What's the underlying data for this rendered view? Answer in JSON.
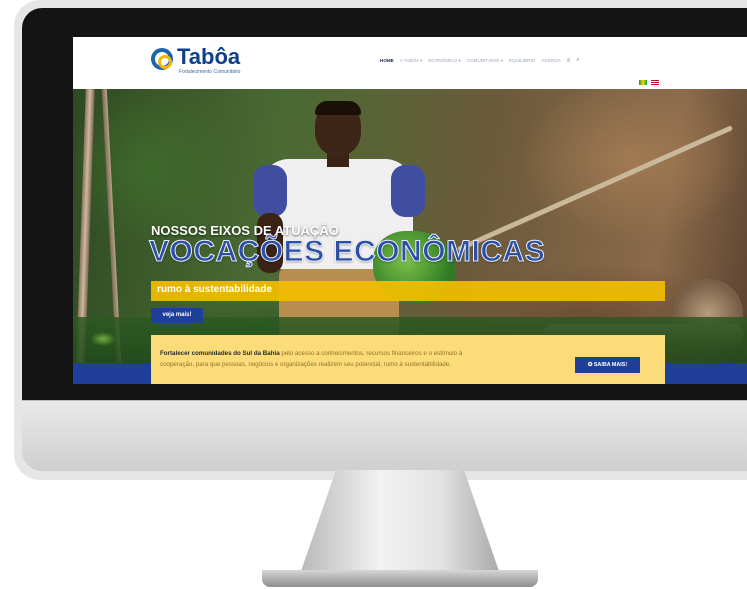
{
  "site": {
    "logo_name": "Tabôa",
    "logo_tagline": "Fortalecimento Comunitário"
  },
  "nav": {
    "items": [
      "HOME",
      "A TABÔA ▾",
      "ECONÔMICO ▾",
      "COMUNITÁRIO ▾",
      "EQUILÍBRIO",
      "AGENDA"
    ],
    "menu_icon": "≡",
    "search_icon": "⌕"
  },
  "hero": {
    "subtitle": "NOSSOS EIXOS DE ATUAÇÃO",
    "title": "VOCAÇÕES ECONÔMICAS",
    "tagline": "rumo à sustentabilidade",
    "cta_label": "veja mais!"
  },
  "info": {
    "bold": "Fortalecer comunidades do Sul da Bahia",
    "text": " pelo acesso a conhecimentos, recursos financeiros e o estímulo à cooperação, para que pessoas, negócios e organizações realizem seu potencial, rumo à sustentabilidade.",
    "button_label": "✪ SAIBA MAIS!"
  }
}
